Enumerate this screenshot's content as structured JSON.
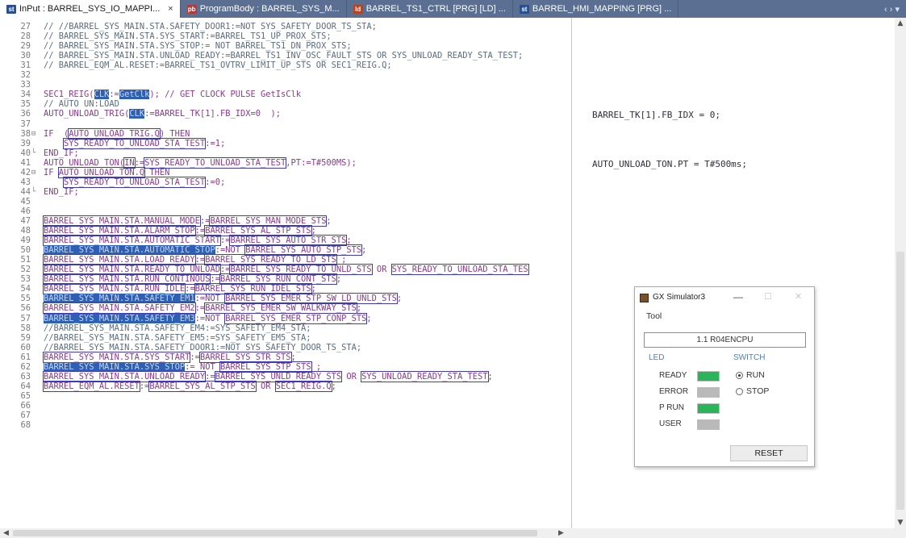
{
  "tabs": [
    {
      "label": "InPut : BARREL_SYS_IO_MAPPI...",
      "icon": "st",
      "icon_color": "#2a4f8f",
      "active": true
    },
    {
      "label": "ProgramBody : BARREL_SYS_M...",
      "icon": "pb",
      "icon_color": "#b23a3a",
      "active": false
    },
    {
      "label": "BARREL_TS1_CTRL [PRG] [LD] ...",
      "icon": "ld",
      "icon_color": "#b8431f",
      "active": false
    },
    {
      "label": "BARREL_HMI_MAPPING [PRG] ...",
      "icon": "st",
      "icon_color": "#2a4f8f",
      "active": false
    }
  ],
  "tab_menu_glyph": "‹ › ▾",
  "code_lines": [
    {
      "n": "27",
      "parts": [
        {
          "t": "// //BARREL_SYS_MAIN.STA.SAFETY_DOOR1:=NOT SYS_SAFETY_DOOR_TS_STA;",
          "c": "cm"
        }
      ]
    },
    {
      "n": "28",
      "parts": [
        {
          "t": "// BARREL_SYS_MAIN.STA.SYS_START:=BARREL_TS1_UP_PROX_STS;",
          "c": "cm"
        }
      ]
    },
    {
      "n": "29",
      "parts": [
        {
          "t": "// BARREL_SYS_MAIN.STA.SYS_STOP:= NOT BARREL_TS1_DN_PROX_STS;",
          "c": "cm"
        }
      ]
    },
    {
      "n": "30",
      "parts": [
        {
          "t": "// BARREL_SYS_MAIN.STA.UNLOAD_READY:=BARREL_TS1_INV_OSC_FAULT_STS OR SYS_UNLOAD_READY_STA_TEST;",
          "c": "cm"
        }
      ]
    },
    {
      "n": "31",
      "parts": [
        {
          "t": "// BARREL_EQM_AL.RESET:=BARREL_TS1_OVTRV_LIMIT_UP_STS OR SEC1_REIG.Q;",
          "c": "cm"
        }
      ]
    },
    {
      "n": "32",
      "parts": []
    },
    {
      "n": "33",
      "parts": []
    },
    {
      "n": "34",
      "parts": [
        {
          "t": "SEC1_REIG("
        },
        {
          "t": "CLK",
          "c": "hl"
        },
        {
          "t": ":="
        },
        {
          "t": "GetClk",
          "c": "hl"
        },
        {
          "t": "); // GET CLOCK PULSE GetIsClk"
        }
      ]
    },
    {
      "n": "35",
      "parts": [
        {
          "t": "// AUTO UN:LOAD",
          "c": "cm"
        }
      ]
    },
    {
      "n": "36",
      "parts": [
        {
          "t": "AUTO_UNLOAD_TRIG("
        },
        {
          "t": "CLK",
          "c": "hl"
        },
        {
          "t": ":=BARREL_TK[1].FB_IDX=0  );"
        }
      ]
    },
    {
      "n": "37",
      "parts": []
    },
    {
      "n": "38",
      "fold": "⊟",
      "parts": [
        {
          "t": "IF  ("
        },
        {
          "t": "AUTO_UNLOAD_TRIG.Q",
          "c": "bx"
        },
        {
          "t": ") THEN"
        }
      ]
    },
    {
      "n": "39",
      "parts": [
        {
          "t": "    "
        },
        {
          "t": "SYS_READY_TO_UNLOAD_STA_TEST",
          "c": "bx"
        },
        {
          "t": ":=1;"
        }
      ]
    },
    {
      "n": "40",
      "fold": "└",
      "parts": [
        {
          "t": "END_IF;"
        }
      ]
    },
    {
      "n": "41",
      "parts": [
        {
          "t": "AUTO_UNLOAD_TON("
        },
        {
          "t": "IN",
          "c": "bx"
        },
        {
          "t": ":="
        },
        {
          "t": "SYS_READY_TO_UNLOAD_STA_TEST",
          "c": "bx"
        },
        {
          "t": ",PT:=T#500MS);"
        }
      ]
    },
    {
      "n": "42",
      "fold": "⊟",
      "parts": [
        {
          "t": "IF "
        },
        {
          "t": "AUTO_UNLOAD_TON.Q",
          "c": "bx"
        },
        {
          "t": " THEN"
        }
      ]
    },
    {
      "n": "43",
      "parts": [
        {
          "t": "    "
        },
        {
          "t": "SYS_READY_TO_UNLOAD_STA_TEST",
          "c": "bx"
        },
        {
          "t": ":=0;"
        }
      ]
    },
    {
      "n": "44",
      "fold": "└",
      "parts": [
        {
          "t": "END_IF;"
        }
      ]
    },
    {
      "n": "45",
      "parts": []
    },
    {
      "n": "46",
      "parts": []
    },
    {
      "n": "47",
      "parts": [
        {
          "t": "BARREL_SYS_MAIN.STA.MANUAL_MODE",
          "c": "bx"
        },
        {
          "t": ":="
        },
        {
          "t": "BARREL_SYS_MAN_MODE_STS",
          "c": "bx"
        },
        {
          "t": ";"
        }
      ]
    },
    {
      "n": "48",
      "parts": [
        {
          "t": "BARREL_SYS_MAIN.STA.ALARM_STOP",
          "c": "bx"
        },
        {
          "t": ":="
        },
        {
          "t": "BARREL_SYS_AL_STP_STS",
          "c": "bx"
        },
        {
          "t": ";"
        }
      ]
    },
    {
      "n": "49",
      "parts": [
        {
          "t": "BARREL_SYS_MAIN.STA.AUTOMATIC_START",
          "c": "bx"
        },
        {
          "t": ":="
        },
        {
          "t": "BARREL_SYS_AUTO_STR_STS",
          "c": "bx"
        },
        {
          "t": ";"
        }
      ]
    },
    {
      "n": "50",
      "parts": [
        {
          "t": "BARREL_SYS_MAIN.STA.AUTOMATIC_STOP",
          "c": "hl"
        },
        {
          "t": ":=NOT "
        },
        {
          "t": "BARREL_SYS_AUTO_STP_STS",
          "c": "bx"
        },
        {
          "t": ";"
        }
      ]
    },
    {
      "n": "51",
      "parts": [
        {
          "t": "BARREL_SYS_MAIN.STA.LOAD_READY",
          "c": "bx"
        },
        {
          "t": ":="
        },
        {
          "t": "BARREL_SYS_READY_TO_LD_STS",
          "c": "bx"
        },
        {
          "t": " ;"
        }
      ]
    },
    {
      "n": "52",
      "parts": [
        {
          "t": "BARREL_SYS_MAIN.STA.READY_TO_UNLOAD",
          "c": "bx"
        },
        {
          "t": ":="
        },
        {
          "t": "BARREL_SYS_READY_TO_UNLD_STS",
          "c": "bx"
        },
        {
          "t": " OR "
        },
        {
          "t": "SYS_READY_TO_UNLOAD_STA_TES",
          "c": "bx"
        }
      ]
    },
    {
      "n": "53",
      "parts": [
        {
          "t": "BARREL_SYS_MAIN.STA.RUN_CONTINOUS",
          "c": "bx"
        },
        {
          "t": ":="
        },
        {
          "t": "BARREL_SYS_RUN_CONT_STS",
          "c": "bx"
        },
        {
          "t": ";"
        }
      ]
    },
    {
      "n": "54",
      "parts": [
        {
          "t": "BARREL_SYS_MAIN.STA.RUN_IDLE",
          "c": "bx"
        },
        {
          "t": ":="
        },
        {
          "t": "BARREL_SYS_RUN_IDEL_STS",
          "c": "bx"
        },
        {
          "t": ";"
        }
      ]
    },
    {
      "n": "55",
      "parts": [
        {
          "t": "BARREL_SYS_MAIN.STA.SAFETY_EM1",
          "c": "hl"
        },
        {
          "t": ":=NOT "
        },
        {
          "t": "BARREL_SYS_EMER_STP_SW_LD_UNLD_STS",
          "c": "bx"
        },
        {
          "t": ";"
        }
      ]
    },
    {
      "n": "56",
      "parts": [
        {
          "t": "BARREL_SYS_MAIN.STA.SAFETY_EM2",
          "c": "bx"
        },
        {
          "t": ":="
        },
        {
          "t": "BARREL_SYS_EMER_SW_WALKWAY_STS",
          "c": "bx"
        },
        {
          "t": ";"
        }
      ]
    },
    {
      "n": "57",
      "parts": [
        {
          "t": "BARREL_SYS_MAIN.STA.SAFETY_EM3",
          "c": "hl"
        },
        {
          "t": ":=NOT "
        },
        {
          "t": "BARREL_SYS_EMER_STP_CONP_STS",
          "c": "bx"
        },
        {
          "t": ";"
        }
      ]
    },
    {
      "n": "58",
      "parts": [
        {
          "t": "//BARREL_SYS_MAIN.STA.SAFETY_EM4:=SYS_SAFETY_EM4_STA;",
          "c": "cm"
        }
      ]
    },
    {
      "n": "59",
      "parts": [
        {
          "t": "//BARREL_SYS_MAIN.STA.SAFETY_EM5:=SYS_SAFETY_EM5_STA;",
          "c": "cm"
        }
      ]
    },
    {
      "n": "60",
      "parts": [
        {
          "t": "//BARREL_SYS_MAIN.STA.SAFETY_DOOR1:=NOT SYS_SAFETY_DOOR_TS_STA;",
          "c": "cm"
        }
      ]
    },
    {
      "n": "61",
      "parts": [
        {
          "t": "BARREL_SYS_MAIN.STA.SYS_START",
          "c": "bx"
        },
        {
          "t": ":="
        },
        {
          "t": "BARREL_SYS_STR_STS",
          "c": "bx"
        },
        {
          "t": ";"
        }
      ]
    },
    {
      "n": "62",
      "parts": [
        {
          "t": "BARREL_SYS_MAIN.STA.SYS_STOP",
          "c": "hl"
        },
        {
          "t": ":= NOT "
        },
        {
          "t": "BARREL_SYS_STP_STS",
          "c": "bx"
        },
        {
          "t": " ;"
        }
      ]
    },
    {
      "n": "63",
      "parts": [
        {
          "t": "BARREL_SYS_MAIN.STA.UNLOAD_READY",
          "c": "bx"
        },
        {
          "t": ":="
        },
        {
          "t": "BARREL_SYS_UNLD_READY_STS",
          "c": "bx"
        },
        {
          "t": " OR "
        },
        {
          "t": "SYS_UNLOAD_READY_STA_TEST",
          "c": "bx"
        },
        {
          "t": ";"
        }
      ]
    },
    {
      "n": "64",
      "parts": [
        {
          "t": "BARREL_EQM_AL.RESET",
          "c": "bx"
        },
        {
          "t": ":="
        },
        {
          "t": "BARREL_SYS_AL_STP_STS",
          "c": "bx"
        },
        {
          "t": " OR "
        },
        {
          "t": "SEC1_REIG.Q",
          "c": "bx"
        },
        {
          "t": ";"
        }
      ]
    },
    {
      "n": "65",
      "parts": []
    },
    {
      "n": "66",
      "parts": []
    },
    {
      "n": "67",
      "parts": []
    },
    {
      "n": "68",
      "parts": []
    }
  ],
  "monitor": [
    {
      "line": "36",
      "text": "BARREL_TK[1].FB_IDX = 0;"
    },
    {
      "line": "41",
      "text": "AUTO_UNLOAD_TON.PT = T#500ms;"
    }
  ],
  "simulator": {
    "title": "GX Simulator3",
    "menu": "Tool",
    "cpu": "1.1  R04ENCPU",
    "led_header": "LED",
    "switch_header": "SWITCH",
    "leds": [
      {
        "label": "READY",
        "color": "#2bb55a"
      },
      {
        "label": "ERROR",
        "color": "#b9b9b9"
      },
      {
        "label": "P RUN",
        "color": "#2bb55a"
      },
      {
        "label": "USER",
        "color": "#b9b9b9"
      }
    ],
    "switches": [
      {
        "label": "RUN",
        "selected": true
      },
      {
        "label": "STOP",
        "selected": false
      }
    ],
    "reset_label": "RESET",
    "min_glyph": "—",
    "max_glyph": "☐",
    "close_glyph": "✕"
  },
  "scroll": {
    "up": "▲",
    "down": "▼",
    "left": "◀",
    "right": "▶"
  }
}
